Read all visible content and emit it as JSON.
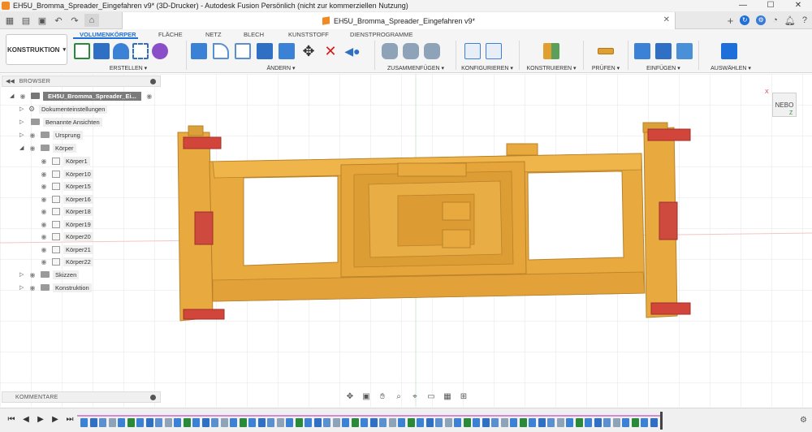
{
  "window": {
    "title": "EH5U_Bromma_Spreader_Eingefahren v9* (3D-Drucker) - Autodesk Fusion Persönlich (nicht zur kommerziellen Nutzung)",
    "controls": [
      "—",
      "☐",
      "✕"
    ]
  },
  "document_tab": {
    "title": "EH5U_Bromma_Spreader_Eingefahren v9*",
    "close": "✕"
  },
  "quick_access": {
    "icons": [
      "grid-icon",
      "file-icon",
      "save-icon",
      "undo-icon",
      "redo-icon",
      "home-icon"
    ]
  },
  "right_icons": [
    "add-tab-icon",
    "online-status-icon",
    "extensions-icon",
    "job-status-icon",
    "notifications-icon",
    "help-icon"
  ],
  "toolbar": {
    "workspace": "KONSTRUKTION",
    "tabs": [
      "VOLUMENKÖRPER",
      "FLÄCHE",
      "NETZ",
      "BLECH",
      "KUNSTSTOFF",
      "DIENSTPROGRAMME"
    ],
    "active_tab": "VOLUMENKÖRPER",
    "groups": [
      {
        "label": "ERSTELLEN ▾"
      },
      {
        "label": "ÄNDERN ▾"
      },
      {
        "label": "ZUSAMMENFÜGEN ▾"
      },
      {
        "label": "KONFIGURIEREN ▾"
      },
      {
        "label": "KONSTRUIEREN ▾"
      },
      {
        "label": "PRÜFEN ▾"
      },
      {
        "label": "EINFÜGEN ▾"
      },
      {
        "label": "AUSWÄHLEN ▾"
      }
    ],
    "accent": "#1e6fd9"
  },
  "browser": {
    "title": "BROWSER",
    "root": "EH5U_Bromma_Spreader_Ei...",
    "items": [
      {
        "label": "Dokumenteinstellungen"
      },
      {
        "label": "Benannte Ansichten"
      },
      {
        "label": "Ursprung"
      },
      {
        "label": "Körper"
      },
      {
        "label": "Körper1"
      },
      {
        "label": "Körper10"
      },
      {
        "label": "Körper15"
      },
      {
        "label": "Körper16"
      },
      {
        "label": "Körper18"
      },
      {
        "label": "Körper19"
      },
      {
        "label": "Körper20"
      },
      {
        "label": "Körper21"
      },
      {
        "label": "Körper22"
      },
      {
        "label": "Skizzen"
      },
      {
        "label": "Konstruktion"
      }
    ]
  },
  "viewcube": {
    "face": "NEBO",
    "axis_x": "X",
    "axis_z": "Z"
  },
  "comments": {
    "title": "KOMMENTARE"
  },
  "model": {
    "body_color": "#e8a93e",
    "twistlock_color": "#d1453b"
  },
  "timeline": {
    "controls": [
      "⏮",
      "◀",
      "▶",
      "▶",
      "⏭"
    ]
  }
}
